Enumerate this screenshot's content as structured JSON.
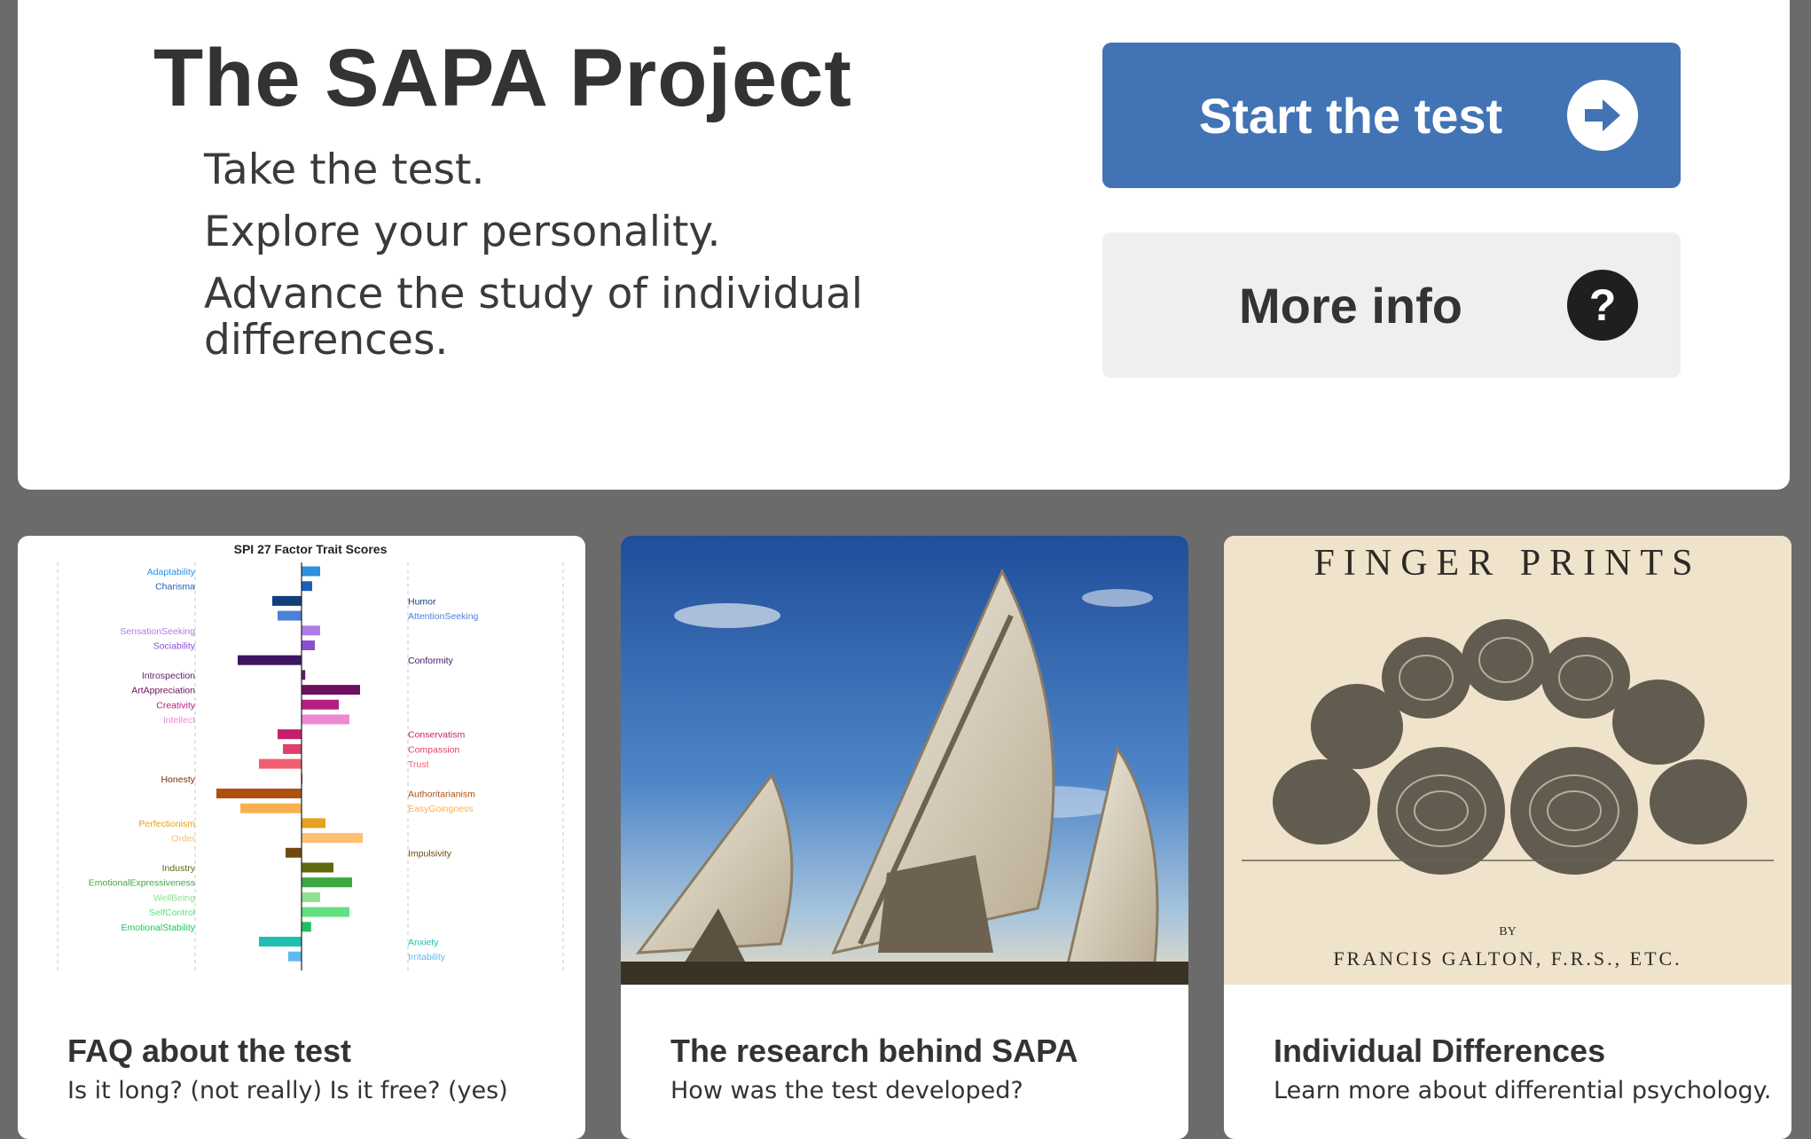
{
  "hero": {
    "title": "The SAPA Project",
    "taglines": [
      "Take the test.",
      "Explore your personality.",
      "Advance the study of individual differences."
    ],
    "start_button": {
      "label": "Start the test",
      "icon": "arrow-right-circle-icon",
      "color": "#4273b5"
    },
    "info_button": {
      "label": "More info",
      "icon": "question-circle-icon",
      "color": "#efefef"
    }
  },
  "cards": [
    {
      "title": "FAQ about the test",
      "subtitle": "Is it long? (not really) Is it free? (yes)",
      "image": "spi-27-factor-chart"
    },
    {
      "title": "The research behind SAPA",
      "subtitle": "How was the test developed?",
      "image": "radio-telescope-dishes-photo"
    },
    {
      "title": "Individual Differences",
      "subtitle": "Learn more about differential psychology.",
      "image": "finger-prints-book-plate",
      "plate_title": "FINGER PRINTS",
      "plate_by": "BY",
      "plate_author": "FRANCIS GALTON, F.R.S., ETC."
    }
  ],
  "chart_data": {
    "type": "bar",
    "title": "SPI 27 Factor Trait Scores",
    "orientation": "horizontal-diverging",
    "xlim": [
      -4,
      4
    ],
    "categories": [
      {
        "label": "Adaptability",
        "side": "left",
        "value": 0.35,
        "color": "#2e8fe0"
      },
      {
        "label": "Charisma",
        "side": "left",
        "value": 0.2,
        "color": "#1f5fb8"
      },
      {
        "label": "Humor",
        "side": "right",
        "value": -0.55,
        "color": "#123e7c"
      },
      {
        "label": "AttentionSeeking",
        "side": "right",
        "value": -0.45,
        "color": "#4f80d8"
      },
      {
        "label": "SensationSeeking",
        "side": "left",
        "value": 0.35,
        "color": "#b07be6"
      },
      {
        "label": "Sociability",
        "side": "left",
        "value": 0.25,
        "color": "#8a4fd0"
      },
      {
        "label": "Conformity",
        "side": "right",
        "value": -1.2,
        "color": "#3d1660"
      },
      {
        "label": "Introspection",
        "side": "left",
        "value": 0.07,
        "color": "#5c1b6e"
      },
      {
        "label": "ArtAppreciation",
        "side": "left",
        "value": 1.1,
        "color": "#6e0f5e"
      },
      {
        "label": "Creativity",
        "side": "left",
        "value": 0.7,
        "color": "#b5207e"
      },
      {
        "label": "Intellect",
        "side": "left",
        "value": 0.9,
        "color": "#ee8ad4"
      },
      {
        "label": "Conservatism",
        "side": "right",
        "value": -0.45,
        "color": "#c61e6c"
      },
      {
        "label": "Compassion",
        "side": "right",
        "value": -0.35,
        "color": "#e0406a"
      },
      {
        "label": "Trust",
        "side": "right",
        "value": -0.8,
        "color": "#f06070"
      },
      {
        "label": "Honesty",
        "side": "left",
        "value": 0.0,
        "color": "#7a2e0c"
      },
      {
        "label": "Authoritarianism",
        "side": "right",
        "value": -1.6,
        "color": "#b05010"
      },
      {
        "label": "EasyGoingness",
        "side": "right",
        "value": -1.15,
        "color": "#fbb050"
      },
      {
        "label": "Perfectionism",
        "side": "left",
        "value": 0.45,
        "color": "#e8a020"
      },
      {
        "label": "Order",
        "side": "left",
        "value": 1.15,
        "color": "#ffc070"
      },
      {
        "label": "Impulsivity",
        "side": "right",
        "value": -0.3,
        "color": "#6e4a10"
      },
      {
        "label": "Industry",
        "side": "left",
        "value": 0.6,
        "color": "#5e6a10"
      },
      {
        "label": "EmotionalExpressiveness",
        "side": "left",
        "value": 0.95,
        "color": "#3aa840"
      },
      {
        "label": "WellBeing",
        "side": "left",
        "value": 0.35,
        "color": "#90e090"
      },
      {
        "label": "SelfControl",
        "side": "left",
        "value": 0.9,
        "color": "#60e080"
      },
      {
        "label": "EmotionalStability",
        "side": "left",
        "value": 0.18,
        "color": "#20c060"
      },
      {
        "label": "Anxiety",
        "side": "right",
        "value": -0.8,
        "color": "#20c0b0"
      },
      {
        "label": "Irritability",
        "side": "right",
        "value": -0.25,
        "color": "#60b8f0"
      }
    ]
  }
}
